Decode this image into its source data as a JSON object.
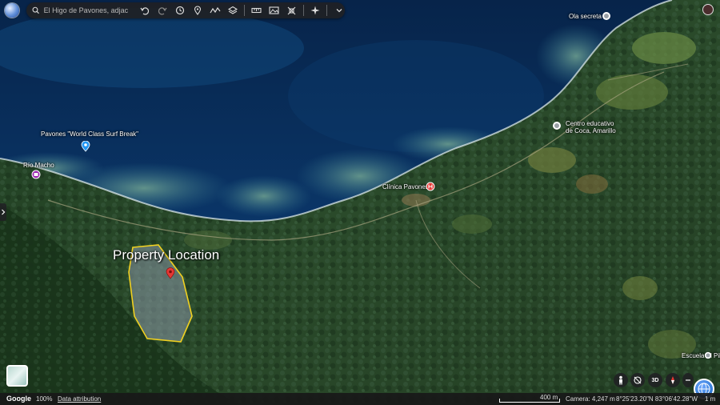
{
  "search": {
    "placeholder": "El Higo de Pavones, adjac"
  },
  "toolbar": {
    "icons": [
      "search-icon",
      "undo-icon",
      "redo-icon",
      "history-icon",
      "pin-icon",
      "path-icon",
      "layers-icon",
      "ruler-icon",
      "photo-icon",
      "projects-icon",
      "sparkle-icon",
      "chevron-down-icon"
    ]
  },
  "map_labels": {
    "ola_secreta": "Ola secreta",
    "surf_break": "Pavones \"World Class Surf Break\"",
    "rio_macho": "Río Macho",
    "centro_line1": "Centro educativo",
    "centro_line2": "de Coca, Amarillo",
    "clinica": "Clínica Pavones",
    "property": "Property Location",
    "escuela": "Escuela El Pilón"
  },
  "controls": {
    "three_d": "3D"
  },
  "status": {
    "google": "Google",
    "zoom": "100%",
    "attribution": "Data attribution",
    "scale": "400 m",
    "camera": "Camera: 4,247 m",
    "coords": "8°25'23.20\"N 83°06'42.28\"W",
    "elevation": "1 m"
  },
  "colors": {
    "property_outline": "#f0d020",
    "pin_red": "#e53935",
    "place_blue": "#2196f3",
    "clinic_red": "#e53935",
    "river_purple": "#9c27b0"
  }
}
